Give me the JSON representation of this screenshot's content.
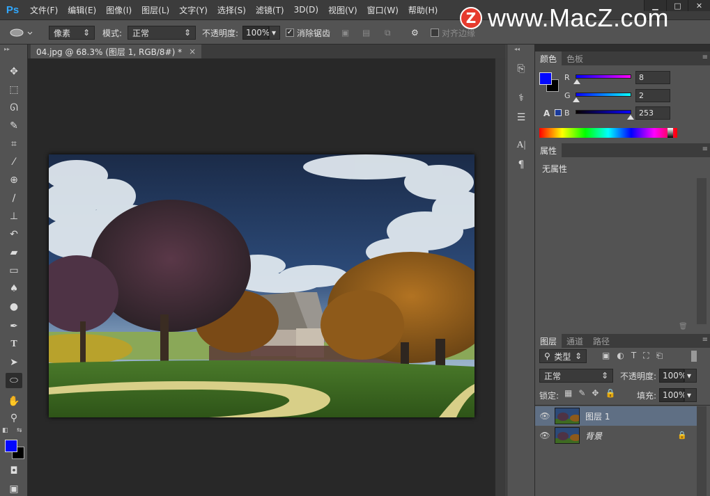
{
  "menubar": {
    "logo": "Ps",
    "items": [
      "文件(F)",
      "编辑(E)",
      "图像(I)",
      "图层(L)",
      "文字(Y)",
      "选择(S)",
      "滤镜(T)",
      "3D(D)",
      "视图(V)",
      "窗口(W)",
      "帮助(H)"
    ]
  },
  "watermark": {
    "logo_letter": "Z",
    "text": "www.MacZ.com"
  },
  "window_controls": {
    "minimize": "▁",
    "restore": "□",
    "close": "✕"
  },
  "options": {
    "shape_icon": "ellipse-icon",
    "mode_label": "像素",
    "blend_label": "模式:",
    "blend_value": "正常",
    "opacity_label": "不透明度:",
    "opacity_value": "100%",
    "antialias_label": "消除锯齿",
    "align_edges_label": "对齐边缘"
  },
  "document": {
    "tab_title": "04.jpg @ 68.3% (图层 1, RGB/8#) *",
    "close_glyph": "×"
  },
  "color_panel": {
    "tabs": [
      "颜色",
      "色板"
    ],
    "foreground": "#0208fd",
    "background": "#000000",
    "r_label": "R",
    "r_value": "8",
    "g_label": "G",
    "g_value": "2",
    "b_label": "B",
    "b_value": "253",
    "r_level": 0.03,
    "g_level": 0.01,
    "b_level": 0.99,
    "web_warning": "A"
  },
  "properties_panel": {
    "tab": "属性",
    "content": "无属性"
  },
  "layers_panel": {
    "tabs": [
      "图层",
      "通道",
      "路径"
    ],
    "filter_label": "类型",
    "blend_value": "正常",
    "opacity_label": "不透明度:",
    "opacity_value": "100%",
    "lock_label": "锁定:",
    "fill_label": "填充:",
    "fill_value": "100%",
    "layers": [
      {
        "name": "图层 1",
        "selected": true,
        "locked": false
      },
      {
        "name": "背景",
        "selected": false,
        "locked": true
      }
    ]
  },
  "toolbar": {
    "tools": [
      "move-tool",
      "marquee-tool",
      "lasso-tool",
      "quick-select-tool",
      "crop-tool",
      "eyedropper-tool",
      "healing-brush-tool",
      "brush-tool",
      "clone-stamp-tool",
      "history-brush-tool",
      "eraser-tool",
      "gradient-tool",
      "blur-tool",
      "dodge-tool",
      "pen-tool",
      "type-tool",
      "path-select-tool",
      "ellipse-tool",
      "hand-tool",
      "zoom-tool"
    ],
    "active_tool": "ellipse-tool",
    "fg_color": "#0208fd",
    "bg_color": "#000000"
  }
}
